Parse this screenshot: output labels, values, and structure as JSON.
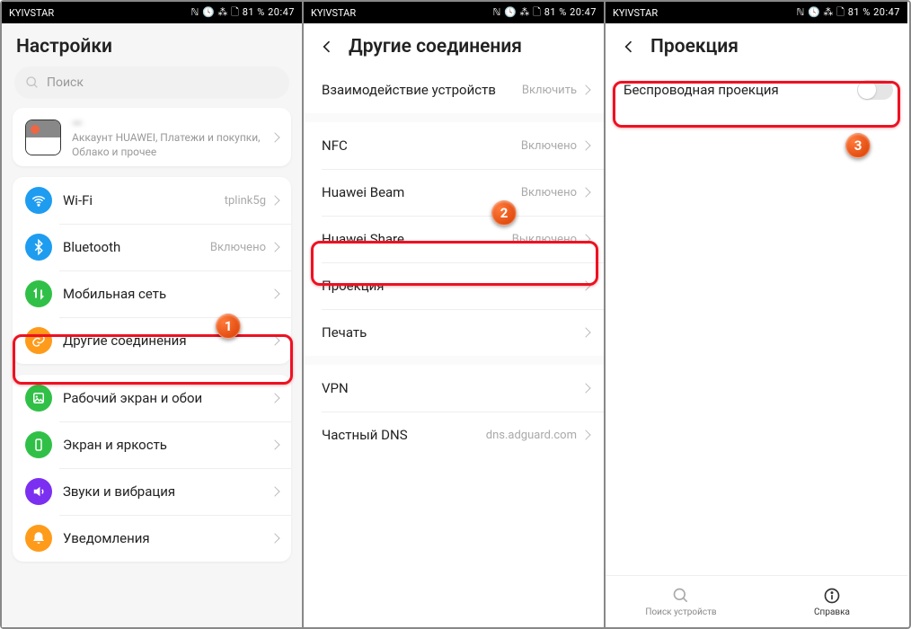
{
  "status": {
    "carrier": "KYIVSTAR",
    "info": "81 %",
    "time": "20:47"
  },
  "panel1": {
    "title": "Настройки",
    "search_placeholder": "Поиск",
    "account": {
      "name": "—",
      "sub": "Аккаунт HUAWEI, Платежи и покупки, Облако и прочее"
    },
    "group_net": [
      {
        "label": "Wi-Fi",
        "value": "tplink5g",
        "color": "#1e9cf0"
      },
      {
        "label": "Bluetooth",
        "value": "Включено",
        "color": "#1e9cf0"
      },
      {
        "label": "Мобильная сеть",
        "value": "",
        "color": "#31c047"
      },
      {
        "label": "Другие соединения",
        "value": "",
        "color": "#ff9b1a"
      }
    ],
    "group_ui": [
      {
        "label": "Рабочий экран и обои",
        "color": "#31c047"
      },
      {
        "label": "Экран и яркость",
        "color": "#31c047"
      },
      {
        "label": "Звуки и вибрация",
        "color": "#7b2ff0"
      },
      {
        "label": "Уведомления",
        "color": "#ff9b1a"
      }
    ]
  },
  "panel2": {
    "title": "Другие соединения",
    "items": [
      {
        "label": "Взаимодействие устройств",
        "value": "Включить"
      },
      {
        "label": "NFC",
        "value": "Включено"
      },
      {
        "label": "Huawei Beam",
        "value": "Включено"
      },
      {
        "label": "Huawei Share",
        "value": "Выключено"
      },
      {
        "label": "Проекция",
        "value": ""
      },
      {
        "label": "Печать",
        "value": ""
      },
      {
        "label": "VPN",
        "value": ""
      },
      {
        "label": "Частный DNS",
        "value": "dns.adguard.com"
      }
    ]
  },
  "panel3": {
    "title": "Проекция",
    "toggle_label": "Беспроводная проекция",
    "tabs": {
      "search": "Поиск устройств",
      "help": "Справка"
    }
  },
  "badges": {
    "b1": "1",
    "b2": "2",
    "b3": "3"
  }
}
